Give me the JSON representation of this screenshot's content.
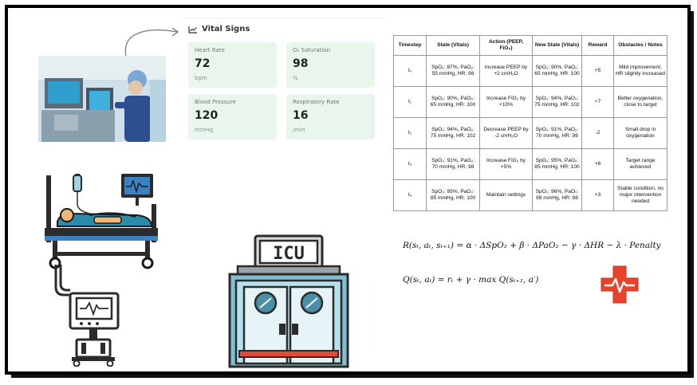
{
  "vitals": {
    "title": "Vital Signs",
    "cards": [
      {
        "label": "Heart Rate",
        "value": "72",
        "unit": "bpm"
      },
      {
        "label": "O₂ Saturation",
        "value": "98",
        "unit": "%"
      },
      {
        "label": "Blood Pressure",
        "value": "120",
        "unit": "mmHg"
      },
      {
        "label": "Respiratory Rate",
        "value": "16",
        "unit": "/min"
      }
    ]
  },
  "table": {
    "headers": [
      "Timestep",
      "State (Vitals)",
      "Action (PEEP, FiO₂)",
      "New State (Vitals)",
      "Reward",
      "Obstacles / Notes"
    ],
    "rows": [
      [
        "t₀",
        "SpO₂: 87%, PaO₂: 55 mmHg, HR: 98",
        "Increase PEEP by +2 cmH₂O",
        "SpO₂: 90%, PaO₂: 65 mmHg, HR: 100",
        "+5",
        "Mild improvement, HR slightly increased"
      ],
      [
        "t₁",
        "SpO₂: 90%, PaO₂: 65 mmHg, HR: 100",
        "Increase FiO₂ by +10%",
        "SpO₂: 94%, PaO₂: 75 mmHg, HR: 102",
        "+7",
        "Better oxygenation, close to target"
      ],
      [
        "t₂",
        "SpO₂: 94%, PaO₂: 75 mmHg, HR: 102",
        "Decrease PEEP by -2 cmH₂O",
        "SpO₂: 91%, PaO₂: 70 mmHg, HR: 98",
        "-2",
        "Small drop in oxygenation"
      ],
      [
        "t₃",
        "SpO₂: 91%, PaO₂: 70 mmHg, HR: 98",
        "Increase FiO₂ by +5%",
        "SpO₂: 95%, PaO₂: 85 mmHg, HR: 100",
        "+6",
        "Target range achieved"
      ],
      [
        "t₄",
        "SpO₂: 95%, PaO₂: 85 mmHg, HR: 100",
        "Maintain settings",
        "SpO₂: 96%, PaO₂: 88 mmHg, HR: 98",
        "+3",
        "Stable condition, no major intervention needed"
      ]
    ]
  },
  "formulas": {
    "reward": "R(sₜ, aₜ, sₜ₊₁) = α · ΔSpO₂ + β · ΔPaO₂ − γ · ΔHR − λ · Penalty",
    "q_update": "Q(sₜ, aₜ) = rₜ + γ · max Q(sₜ₊₁, a′)"
  },
  "icu_sign": "ICU",
  "icons": [
    "patient-bed-icon",
    "ventilator-icon",
    "icu-building-icon",
    "medical-cross-icon",
    "chart-icon"
  ],
  "colors": {
    "card_bg": "#e8f6ec",
    "icu_teal": "#7fbfd0",
    "cross_red": "#e8432c",
    "bed_blue": "#3b82c4"
  }
}
